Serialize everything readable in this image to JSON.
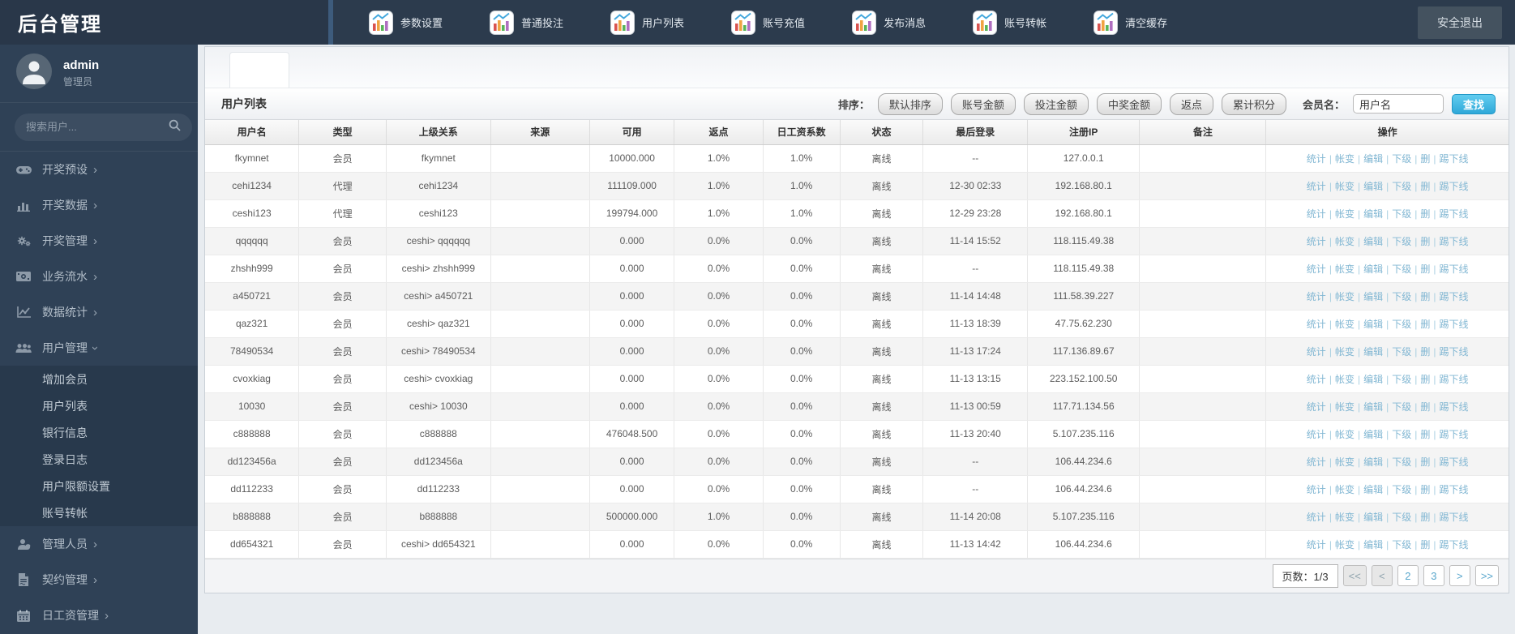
{
  "app": {
    "title": "后台管理",
    "logout_label": "安全退出"
  },
  "topnav": {
    "items": [
      {
        "label": "参数设置",
        "icon": "chart-icon"
      },
      {
        "label": "普通投注",
        "icon": "chart-icon"
      },
      {
        "label": "用户列表",
        "icon": "chart-icon"
      },
      {
        "label": "账号充值",
        "icon": "chart-icon"
      },
      {
        "label": "发布消息",
        "icon": "chart-icon"
      },
      {
        "label": "账号转帐",
        "icon": "chart-icon"
      },
      {
        "label": "清空缓存",
        "icon": "chart-icon"
      }
    ]
  },
  "sidebar": {
    "user": {
      "name": "admin",
      "role": "管理员"
    },
    "search_placeholder": "搜索用户...",
    "menu": [
      {
        "label": "开奖预设",
        "icon": "gamepad-icon",
        "expanded": false
      },
      {
        "label": "开奖数据",
        "icon": "barchart-icon",
        "expanded": false
      },
      {
        "label": "开奖管理",
        "icon": "gears-icon",
        "expanded": false
      },
      {
        "label": "业务流水",
        "icon": "money-icon",
        "expanded": false
      },
      {
        "label": "数据统计",
        "icon": "linechart-icon",
        "expanded": false
      },
      {
        "label": "用户管理",
        "icon": "users-icon",
        "expanded": true,
        "children": [
          "增加会员",
          "用户列表",
          "银行信息",
          "登录日志",
          "用户限额设置",
          "账号转帐"
        ]
      },
      {
        "label": "管理人员",
        "icon": "admin-person-icon",
        "expanded": false
      },
      {
        "label": "契约管理",
        "icon": "contract-icon",
        "expanded": false
      },
      {
        "label": "日工资管理",
        "icon": "calendar-icon",
        "expanded": false
      }
    ]
  },
  "panel": {
    "title": "用户列表",
    "sort_label": "排序：",
    "sort_buttons": [
      "默认排序",
      "账号金额",
      "投注金额",
      "中奖金额",
      "返点",
      "累计积分"
    ],
    "member_label": "会员名：",
    "member_value": "用户名",
    "find_label": "查找"
  },
  "table": {
    "headers": [
      "用户名",
      "类型",
      "上级关系",
      "来源",
      "可用",
      "返点",
      "日工资系数",
      "状态",
      "最后登录",
      "注册IP",
      "备注",
      "操作"
    ],
    "action_labels": [
      "统计",
      "帐变",
      "编辑",
      "下级",
      "删",
      "踢下线"
    ],
    "rows": [
      {
        "username": "fkymnet",
        "type": "会员",
        "parent": "fkymnet",
        "source": "",
        "available": "10000.000",
        "rebate": "1.0%",
        "daily_wage": "1.0%",
        "status": "离线",
        "last_login": "--",
        "reg_ip": "127.0.0.1",
        "note": ""
      },
      {
        "username": "cehi1234",
        "type": "代理",
        "parent": "cehi1234",
        "source": "",
        "available": "111109.000",
        "rebate": "1.0%",
        "daily_wage": "1.0%",
        "status": "离线",
        "last_login": "12-30 02:33",
        "reg_ip": "192.168.80.1",
        "note": ""
      },
      {
        "username": "ceshi123",
        "type": "代理",
        "parent": "ceshi123",
        "source": "",
        "available": "199794.000",
        "rebate": "1.0%",
        "daily_wage": "1.0%",
        "status": "离线",
        "last_login": "12-29 23:28",
        "reg_ip": "192.168.80.1",
        "note": ""
      },
      {
        "username": "qqqqqq",
        "type": "会员",
        "parent": "ceshi> qqqqqq",
        "source": "",
        "available": "0.000",
        "rebate": "0.0%",
        "daily_wage": "0.0%",
        "status": "离线",
        "last_login": "11-14 15:52",
        "reg_ip": "118.115.49.38",
        "note": ""
      },
      {
        "username": "zhshh999",
        "type": "会员",
        "parent": "ceshi> zhshh999",
        "source": "",
        "available": "0.000",
        "rebate": "0.0%",
        "daily_wage": "0.0%",
        "status": "离线",
        "last_login": "--",
        "reg_ip": "118.115.49.38",
        "note": ""
      },
      {
        "username": "a450721",
        "type": "会员",
        "parent": "ceshi> a450721",
        "source": "",
        "available": "0.000",
        "rebate": "0.0%",
        "daily_wage": "0.0%",
        "status": "离线",
        "last_login": "11-14 14:48",
        "reg_ip": "111.58.39.227",
        "note": ""
      },
      {
        "username": "qaz321",
        "type": "会员",
        "parent": "ceshi> qaz321",
        "source": "",
        "available": "0.000",
        "rebate": "0.0%",
        "daily_wage": "0.0%",
        "status": "离线",
        "last_login": "11-13 18:39",
        "reg_ip": "47.75.62.230",
        "note": ""
      },
      {
        "username": "78490534",
        "type": "会员",
        "parent": "ceshi> 78490534",
        "source": "",
        "available": "0.000",
        "rebate": "0.0%",
        "daily_wage": "0.0%",
        "status": "离线",
        "last_login": "11-13 17:24",
        "reg_ip": "117.136.89.67",
        "note": ""
      },
      {
        "username": "cvoxkiag",
        "type": "会员",
        "parent": "ceshi> cvoxkiag",
        "source": "",
        "available": "0.000",
        "rebate": "0.0%",
        "daily_wage": "0.0%",
        "status": "离线",
        "last_login": "11-13 13:15",
        "reg_ip": "223.152.100.50",
        "note": ""
      },
      {
        "username": "10030",
        "type": "会员",
        "parent": "ceshi> 10030",
        "source": "",
        "available": "0.000",
        "rebate": "0.0%",
        "daily_wage": "0.0%",
        "status": "离线",
        "last_login": "11-13 00:59",
        "reg_ip": "117.71.134.56",
        "note": ""
      },
      {
        "username": "c888888",
        "type": "会员",
        "parent": "c888888",
        "source": "",
        "available": "476048.500",
        "rebate": "0.0%",
        "daily_wage": "0.0%",
        "status": "离线",
        "last_login": "11-13 20:40",
        "reg_ip": "5.107.235.116",
        "note": ""
      },
      {
        "username": "dd123456a",
        "type": "会员",
        "parent": "dd123456a",
        "source": "",
        "available": "0.000",
        "rebate": "0.0%",
        "daily_wage": "0.0%",
        "status": "离线",
        "last_login": "--",
        "reg_ip": "106.44.234.6",
        "note": ""
      },
      {
        "username": "dd112233",
        "type": "会员",
        "parent": "dd112233",
        "source": "",
        "available": "0.000",
        "rebate": "0.0%",
        "daily_wage": "0.0%",
        "status": "离线",
        "last_login": "--",
        "reg_ip": "106.44.234.6",
        "note": ""
      },
      {
        "username": "b888888",
        "type": "会员",
        "parent": "b888888",
        "source": "",
        "available": "500000.000",
        "rebate": "1.0%",
        "daily_wage": "0.0%",
        "status": "离线",
        "last_login": "11-14 20:08",
        "reg_ip": "5.107.235.116",
        "note": ""
      },
      {
        "username": "dd654321",
        "type": "会员",
        "parent": "ceshi> dd654321",
        "source": "",
        "available": "0.000",
        "rebate": "0.0%",
        "daily_wage": "0.0%",
        "status": "离线",
        "last_login": "11-13 14:42",
        "reg_ip": "106.44.234.6",
        "note": ""
      }
    ]
  },
  "pagination": {
    "page_label": "页数：1/3",
    "buttons": [
      {
        "name": "page-first",
        "label": "<<",
        "enabled": false
      },
      {
        "name": "page-prev",
        "label": "<",
        "enabled": false
      },
      {
        "name": "page-2",
        "label": "2",
        "enabled": true
      },
      {
        "name": "page-3",
        "label": "3",
        "enabled": true
      },
      {
        "name": "page-next",
        "label": ">",
        "enabled": true
      },
      {
        "name": "page-last",
        "label": ">>",
        "enabled": true
      }
    ]
  }
}
